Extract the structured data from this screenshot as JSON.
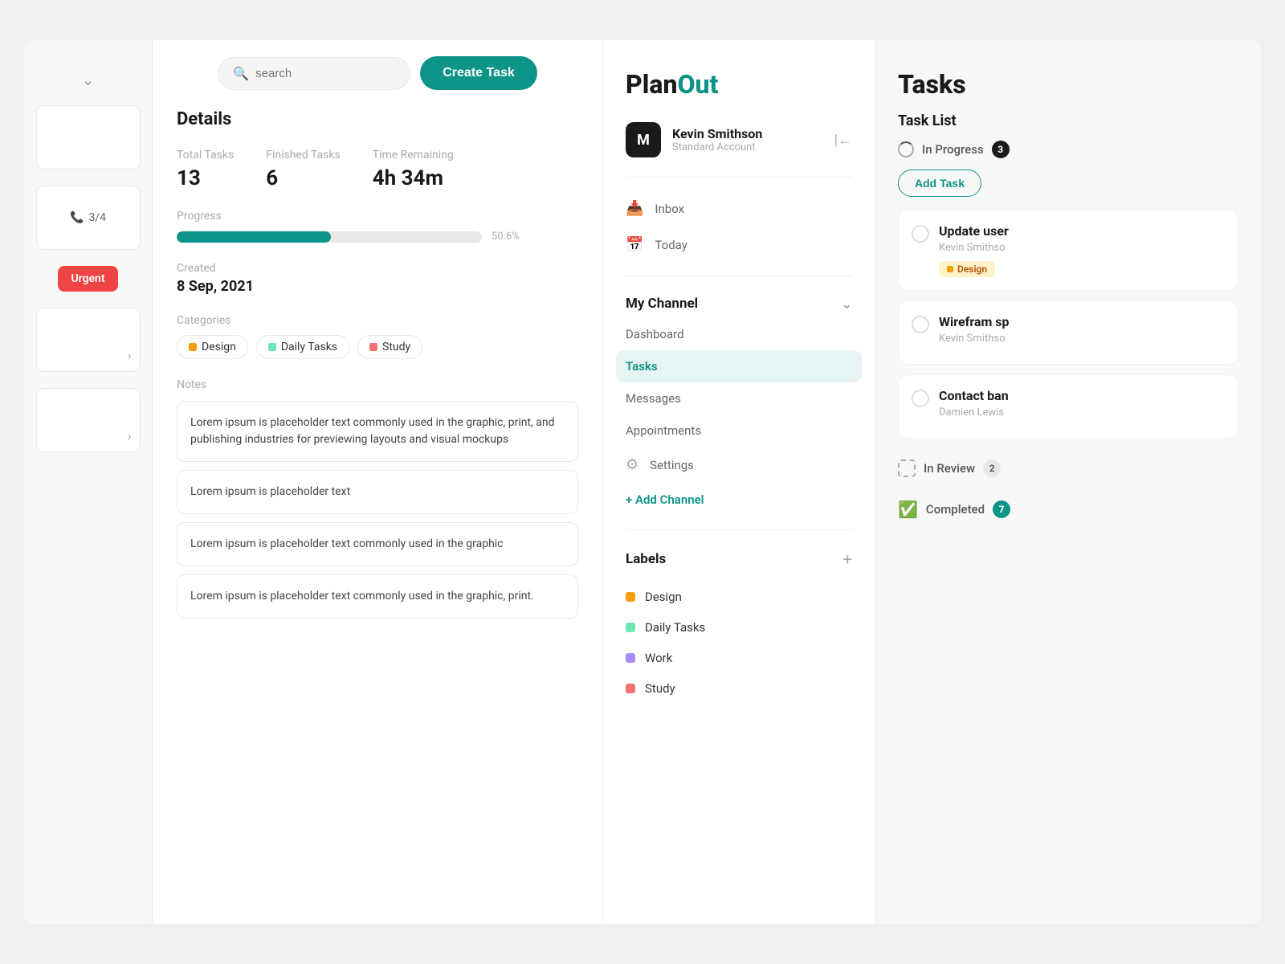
{
  "app": {
    "title": "PlanOut"
  },
  "header": {
    "search_placeholder": "search",
    "create_task_label": "Create Task"
  },
  "details": {
    "title": "Details",
    "total_tasks_label": "Total Tasks",
    "total_tasks_value": "13",
    "finished_tasks_label": "Finished Tasks",
    "finished_tasks_value": "6",
    "time_remaining_label": "Time Remaining",
    "time_remaining_value": "4h 34m",
    "progress_label": "Progress",
    "progress_percent": 50.6,
    "progress_display": "50.6%",
    "created_label": "Created",
    "created_date": "8 Sep, 2021",
    "categories_label": "Categories",
    "categories": [
      {
        "name": "Design",
        "color": "#f59e0b"
      },
      {
        "name": "Daily Tasks",
        "color": "#6ee7b7"
      },
      {
        "name": "Study",
        "color": "#f87171"
      }
    ],
    "notes_label": "Notes",
    "notes": [
      "Lorem ipsum is placeholder text commonly used in the graphic, print, and publishing industries for previewing layouts and visual mockups",
      "Lorem ipsum is placeholder text",
      "Lorem ipsum is placeholder text commonly used in the graphic",
      "Lorem ipsum is placeholder text commonly used in the graphic, print."
    ]
  },
  "sidebar": {
    "brand_plan": "Plan",
    "brand_out": "Out",
    "user": {
      "initial": "M",
      "name": "Kevin Smithson",
      "account": "Standard Account"
    },
    "nav_items": [
      {
        "label": "Inbox",
        "icon": "✉"
      },
      {
        "label": "Today",
        "icon": "📅"
      }
    ],
    "my_channel": {
      "label": "My Channel",
      "items": [
        {
          "label": "Dashboard",
          "active": false
        },
        {
          "label": "Tasks",
          "active": true
        },
        {
          "label": "Messages",
          "active": false
        },
        {
          "label": "Appointments",
          "active": false
        }
      ],
      "settings_label": "Settings"
    },
    "add_channel_label": "+ Add Channel",
    "labels_title": "Labels",
    "labels": [
      {
        "name": "Design",
        "color": "#f59e0b"
      },
      {
        "name": "Daily Tasks",
        "color": "#6ee7b7"
      },
      {
        "name": "Work",
        "color": "#a78bfa"
      },
      {
        "name": "Study",
        "color": "#f87171"
      }
    ]
  },
  "tasks": {
    "title": "Tasks",
    "task_list_title": "Task List",
    "in_progress": {
      "label": "In Progress",
      "count": 3
    },
    "add_task_label": "Add Task",
    "task_items": [
      {
        "title": "Update user",
        "subtitle": "Kevin Smithso",
        "chip": "Design",
        "chip_color": "#f59e0b"
      },
      {
        "title": "Wirefram sp",
        "subtitle": "Kevin Smithso",
        "chip": null
      },
      {
        "title": "Contact ban",
        "subtitle": "Damien Lewis",
        "chip": null
      }
    ],
    "in_review": {
      "label": "In Review",
      "count": 2
    },
    "completed": {
      "label": "Completed",
      "count": 7
    }
  },
  "sidebar_left": {
    "calls_label": "3/4"
  }
}
